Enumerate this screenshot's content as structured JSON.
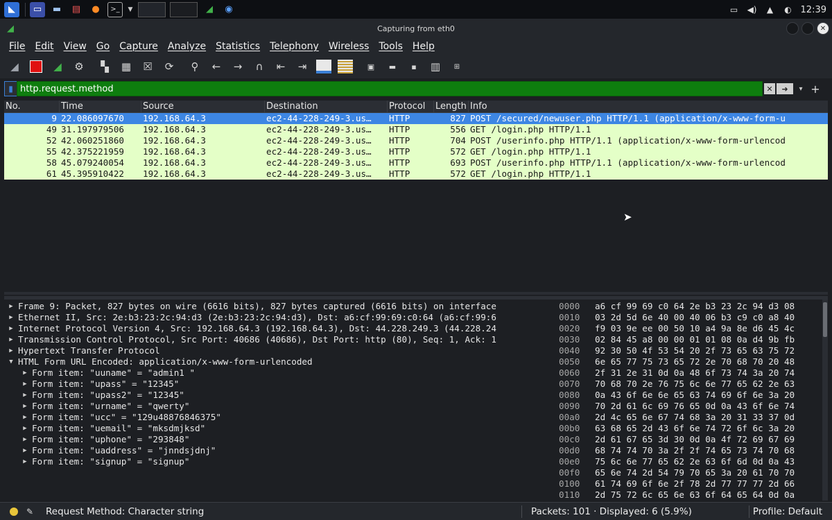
{
  "taskbar": {
    "clock": "12:39"
  },
  "window": {
    "title": "Capturing from eth0"
  },
  "menu": [
    "File",
    "Edit",
    "View",
    "Go",
    "Capture",
    "Analyze",
    "Statistics",
    "Telephony",
    "Wireless",
    "Tools",
    "Help"
  ],
  "filter": {
    "value": "http.request.method"
  },
  "packet_list": {
    "columns": [
      "No.",
      "Time",
      "Source",
      "Destination",
      "Protocol",
      "Length",
      "Info"
    ],
    "rows": [
      {
        "no": "9",
        "time": "22.086097670",
        "src": "192.168.64.3",
        "dst": "ec2-44-228-249-3.us…",
        "proto": "HTTP",
        "len": "827",
        "info": "POST /secured/newuser.php HTTP/1.1  (application/x-www-form-u"
      },
      {
        "no": "49",
        "time": "31.197979506",
        "src": "192.168.64.3",
        "dst": "ec2-44-228-249-3.us…",
        "proto": "HTTP",
        "len": "556",
        "info": "GET /login.php HTTP/1.1"
      },
      {
        "no": "52",
        "time": "42.060251860",
        "src": "192.168.64.3",
        "dst": "ec2-44-228-249-3.us…",
        "proto": "HTTP",
        "len": "704",
        "info": "POST /userinfo.php HTTP/1.1  (application/x-www-form-urlencod"
      },
      {
        "no": "55",
        "time": "42.375221959",
        "src": "192.168.64.3",
        "dst": "ec2-44-228-249-3.us…",
        "proto": "HTTP",
        "len": "572",
        "info": "GET /login.php HTTP/1.1"
      },
      {
        "no": "58",
        "time": "45.079240054",
        "src": "192.168.64.3",
        "dst": "ec2-44-228-249-3.us…",
        "proto": "HTTP",
        "len": "693",
        "info": "POST /userinfo.php HTTP/1.1  (application/x-www-form-urlencod"
      },
      {
        "no": "61",
        "time": "45.395910422",
        "src": "192.168.64.3",
        "dst": "ec2-44-228-249-3.us…",
        "proto": "HTTP",
        "len": "572",
        "info": "GET /login.php HTTP/1.1"
      }
    ]
  },
  "details": [
    {
      "text": "Frame 9: Packet, 827 bytes on wire (6616 bits), 827 bytes captured (6616 bits) on interface",
      "expanded": false,
      "child": false
    },
    {
      "text": "Ethernet II, Src: 2e:b3:23:2c:94:d3 (2e:b3:23:2c:94:d3), Dst: a6:cf:99:69:c0:64 (a6:cf:99:6",
      "expanded": false,
      "child": false
    },
    {
      "text": "Internet Protocol Version 4, Src: 192.168.64.3 (192.168.64.3), Dst: 44.228.249.3 (44.228.24",
      "expanded": false,
      "child": false
    },
    {
      "text": "Transmission Control Protocol, Src Port: 40686 (40686), Dst Port: http (80), Seq: 1, Ack: 1",
      "expanded": false,
      "child": false
    },
    {
      "text": "Hypertext Transfer Protocol",
      "expanded": false,
      "child": false
    },
    {
      "text": "HTML Form URL Encoded: application/x-www-form-urlencoded",
      "expanded": true,
      "child": false
    },
    {
      "text": "Form item: \"uuname\" = \"admin1 \"",
      "expanded": false,
      "child": true
    },
    {
      "text": "Form item: \"upass\" = \"12345\"",
      "expanded": false,
      "child": true
    },
    {
      "text": "Form item: \"upass2\" = \"12345\"",
      "expanded": false,
      "child": true
    },
    {
      "text": "Form item: \"urname\" = \"qwerty\"",
      "expanded": false,
      "child": true
    },
    {
      "text": "Form item: \"ucc\" = \"129u48876846375\"",
      "expanded": false,
      "child": true
    },
    {
      "text": "Form item: \"uemail\" = \"mksdmjksd\"",
      "expanded": false,
      "child": true
    },
    {
      "text": "Form item: \"uphone\" = \"293848\"",
      "expanded": false,
      "child": true
    },
    {
      "text": "Form item: \"uaddress\" = \"jnndsjdnj\"",
      "expanded": false,
      "child": true
    },
    {
      "text": "Form item: \"signup\" = \"signup\"",
      "expanded": false,
      "child": true
    }
  ],
  "hex": [
    {
      "off": "0000",
      "bytes": "a6 cf 99 69 c0 64 2e b3  23 2c 94 d3 08"
    },
    {
      "off": "0010",
      "bytes": "03 2d 5d 6e 40 00 40 06  b3 c9 c0 a8 40"
    },
    {
      "off": "0020",
      "bytes": "f9 03 9e ee 00 50 10 a4  9a 8e d6 45 4c"
    },
    {
      "off": "0030",
      "bytes": "02 84 45 a8 00 00 01 01  08 0a d4 9b fb"
    },
    {
      "off": "0040",
      "bytes": "92 30 50 4f 53 54 20 2f  73 65 63 75 72"
    },
    {
      "off": "0050",
      "bytes": "6e 65 77 75 73 65 72 2e  70 68 70 20 48"
    },
    {
      "off": "0060",
      "bytes": "2f 31 2e 31 0d 0a 48 6f  73 74 3a 20 74"
    },
    {
      "off": "0070",
      "bytes": "70 68 70 2e 76 75 6c 6e  77 65 62 2e 63"
    },
    {
      "off": "0080",
      "bytes": "0a 43 6f 6e 6e 65 63 74  69 6f 6e 3a 20"
    },
    {
      "off": "0090",
      "bytes": "70 2d 61 6c 69 76 65 0d  0a 43 6f 6e 74"
    },
    {
      "off": "00a0",
      "bytes": "2d 4c 65 6e 67 74 68 3a  20 31 33 37 0d"
    },
    {
      "off": "00b0",
      "bytes": "63 68 65 2d 43 6f 6e 74  72 6f 6c 3a 20"
    },
    {
      "off": "00c0",
      "bytes": "2d 61 67 65 3d 30 0d 0a  4f 72 69 67 69"
    },
    {
      "off": "00d0",
      "bytes": "68 74 74 70 3a 2f 2f 74  65 73 74 70 68"
    },
    {
      "off": "00e0",
      "bytes": "75 6c 6e 77 65 62 2e 63  6f 6d 0d 0a 43"
    },
    {
      "off": "00f0",
      "bytes": "65 6e 74 2d 54 79 70 65  3a 20 61 70 70"
    },
    {
      "off": "0100",
      "bytes": "61 74 69 6f 6e 2f 78 2d  77 77 77 2d 66"
    },
    {
      "off": "0110",
      "bytes": "2d 75 72 6c 65 6e 63 6f  64 65 64 0d 0a"
    }
  ],
  "status": {
    "field": "Request Method: Character string",
    "packets": "Packets: 101 · Displayed: 6 (5.9%)",
    "profile": "Profile: Default"
  }
}
